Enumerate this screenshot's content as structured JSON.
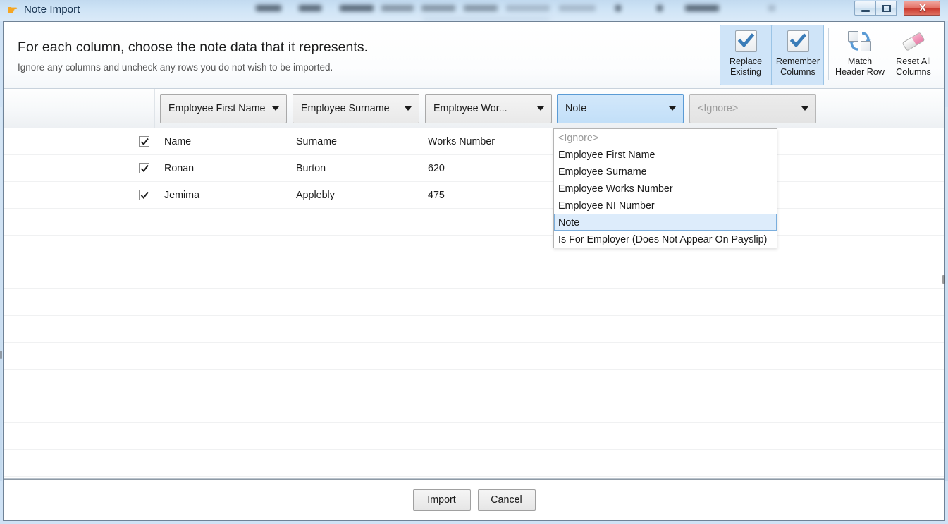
{
  "window": {
    "title": "Note Import",
    "logo_icon": "brightpay-logo-icon",
    "controls": {
      "minimize_icon": "minimize-icon",
      "maximize_icon": "maximize-icon",
      "close_label": "X",
      "close_icon": "close-icon"
    }
  },
  "header": {
    "title": "For each column, choose the note data that it represents.",
    "subtitle": "Ignore any columns and uncheck any rows you do not wish to be imported."
  },
  "toolbar": {
    "buttons": [
      {
        "label": "Replace\nExisting",
        "icon": "checkmark-icon",
        "toggled": true
      },
      {
        "label": "Remember\nColumns",
        "icon": "checkmark-icon",
        "toggled": true
      },
      {
        "label": "Match\nHeader Row",
        "icon": "match-header-row-icon",
        "toggled": false
      },
      {
        "label": "Reset All\nColumns",
        "icon": "eraser-icon",
        "toggled": false
      }
    ]
  },
  "columns": [
    {
      "value": "Employee First Name",
      "state": "normal"
    },
    {
      "value": "Employee Surname",
      "state": "normal"
    },
    {
      "value": "Employee Wor...",
      "state": "normal"
    },
    {
      "value": "Note",
      "state": "selected"
    },
    {
      "value": "<Ignore>",
      "state": "disabled"
    }
  ],
  "dropdown": {
    "open": true,
    "options": [
      {
        "label": "<Ignore>",
        "muted": true,
        "highlighted": false
      },
      {
        "label": "Employee First Name",
        "muted": false,
        "highlighted": false
      },
      {
        "label": "Employee Surname",
        "muted": false,
        "highlighted": false
      },
      {
        "label": "Employee Works Number",
        "muted": false,
        "highlighted": false
      },
      {
        "label": "Employee NI Number",
        "muted": false,
        "highlighted": false
      },
      {
        "label": "Note",
        "muted": false,
        "highlighted": true
      },
      {
        "label": "Is For Employer (Does Not Appear On Payslip)",
        "muted": false,
        "highlighted": false
      }
    ]
  },
  "grid": {
    "rows": [
      {
        "checked": true,
        "cells": [
          "Name",
          "Surname",
          "Works Number",
          ""
        ]
      },
      {
        "checked": true,
        "cells": [
          "Ronan",
          "Burton",
          "620",
          ""
        ]
      },
      {
        "checked": true,
        "cells": [
          "Jemima",
          "Applebly",
          "475",
          ""
        ]
      }
    ],
    "empty_row_count": 10
  },
  "footer": {
    "import_label": "Import",
    "cancel_label": "Cancel"
  },
  "colors": {
    "accent": "#5b9bd5",
    "selection": "#cfe4f8",
    "highlight": "#ddecfb",
    "close_red": "#c9372c",
    "logo_orange": "#f5a623"
  }
}
